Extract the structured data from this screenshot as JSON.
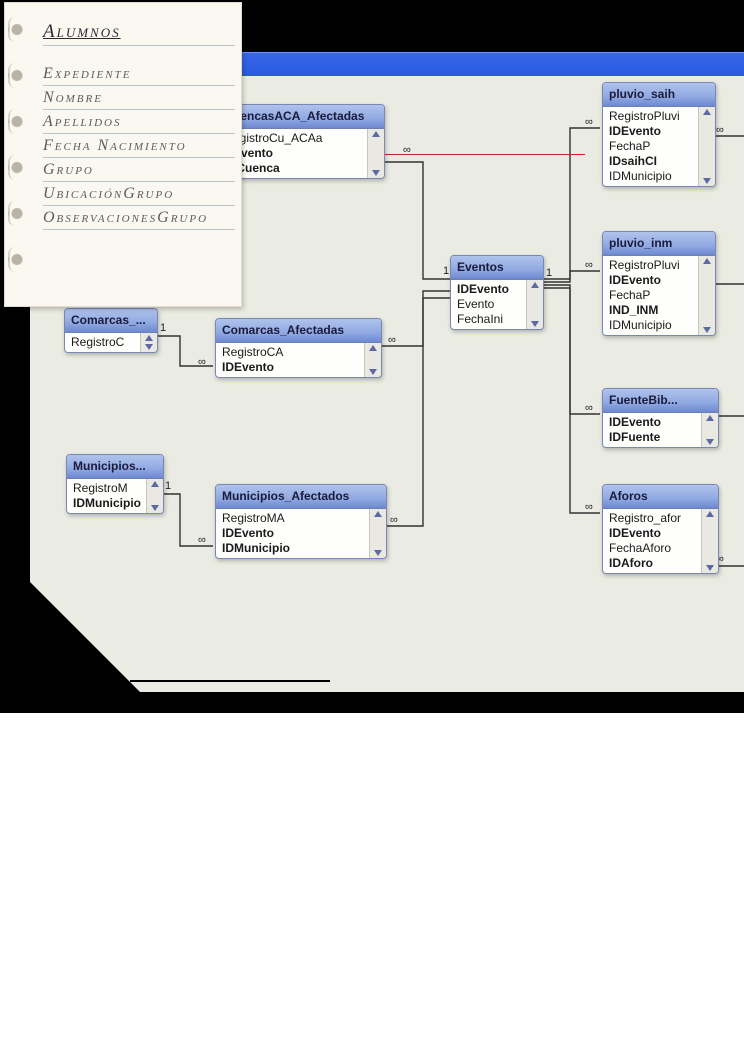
{
  "notebook": {
    "title": "Alumnos",
    "rows": [
      "Expediente",
      "Nombre",
      "Apellidos",
      "Fecha Nacimiento",
      "Grupo",
      "UbicaciónGrupo",
      "ObservacionesGrupo"
    ]
  },
  "tables": {
    "cuencas_aca": {
      "title": "uencasACA_Afectadas",
      "fields": [
        {
          "label": "egistroCu_ACAa",
          "bold": false
        },
        {
          "label": "Evento",
          "bold": true
        },
        {
          "label": "ICuenca",
          "bold": true
        }
      ]
    },
    "pluvio_saih": {
      "title": "pluvio_saih",
      "fields": [
        {
          "label": "RegistroPluvi",
          "bold": false
        },
        {
          "label": "IDEvento",
          "bold": true
        },
        {
          "label": "FechaP",
          "bold": false
        },
        {
          "label": "IDsaihCI",
          "bold": true
        },
        {
          "label": "IDMunicipio",
          "bold": false
        }
      ]
    },
    "pluvio_inm": {
      "title": "pluvio_inm",
      "fields": [
        {
          "label": "RegistroPluvi",
          "bold": false
        },
        {
          "label": "IDEvento",
          "bold": true
        },
        {
          "label": "FechaP",
          "bold": false
        },
        {
          "label": "IND_INM",
          "bold": true
        },
        {
          "label": "IDMunicipio",
          "bold": false
        }
      ]
    },
    "comarcas": {
      "title": "Comarcas_...",
      "fields": [
        {
          "label": "RegistroC",
          "bold": false
        }
      ]
    },
    "comarcas_afectadas": {
      "title": "Comarcas_Afectadas",
      "fields": [
        {
          "label": "RegistroCA",
          "bold": false
        },
        {
          "label": "IDEvento",
          "bold": true
        }
      ]
    },
    "eventos": {
      "title": "Eventos",
      "fields": [
        {
          "label": "IDEvento",
          "bold": true
        },
        {
          "label": "Evento",
          "bold": false
        },
        {
          "label": "FechaIni",
          "bold": false
        }
      ]
    },
    "fuentebib": {
      "title": "FuenteBib...",
      "fields": [
        {
          "label": "IDEvento",
          "bold": true
        },
        {
          "label": "IDFuente",
          "bold": true
        }
      ]
    },
    "municipios": {
      "title": "Municipios...",
      "fields": [
        {
          "label": "RegistroM",
          "bold": false
        },
        {
          "label": "IDMunicipio",
          "bold": true
        }
      ]
    },
    "municipios_afectados": {
      "title": "Municipios_Afectados",
      "fields": [
        {
          "label": "RegistroMA",
          "bold": false
        },
        {
          "label": "IDEvento",
          "bold": true
        },
        {
          "label": "IDMunicipio",
          "bold": true
        }
      ]
    },
    "aforos": {
      "title": "Aforos",
      "fields": [
        {
          "label": "Registro_afor",
          "bold": false
        },
        {
          "label": "IDEvento",
          "bold": true
        },
        {
          "label": "FechaAforo",
          "bold": false
        },
        {
          "label": "IDAforo",
          "bold": true
        }
      ]
    }
  },
  "rel_labels": {
    "one": "1",
    "inf": "∞"
  }
}
